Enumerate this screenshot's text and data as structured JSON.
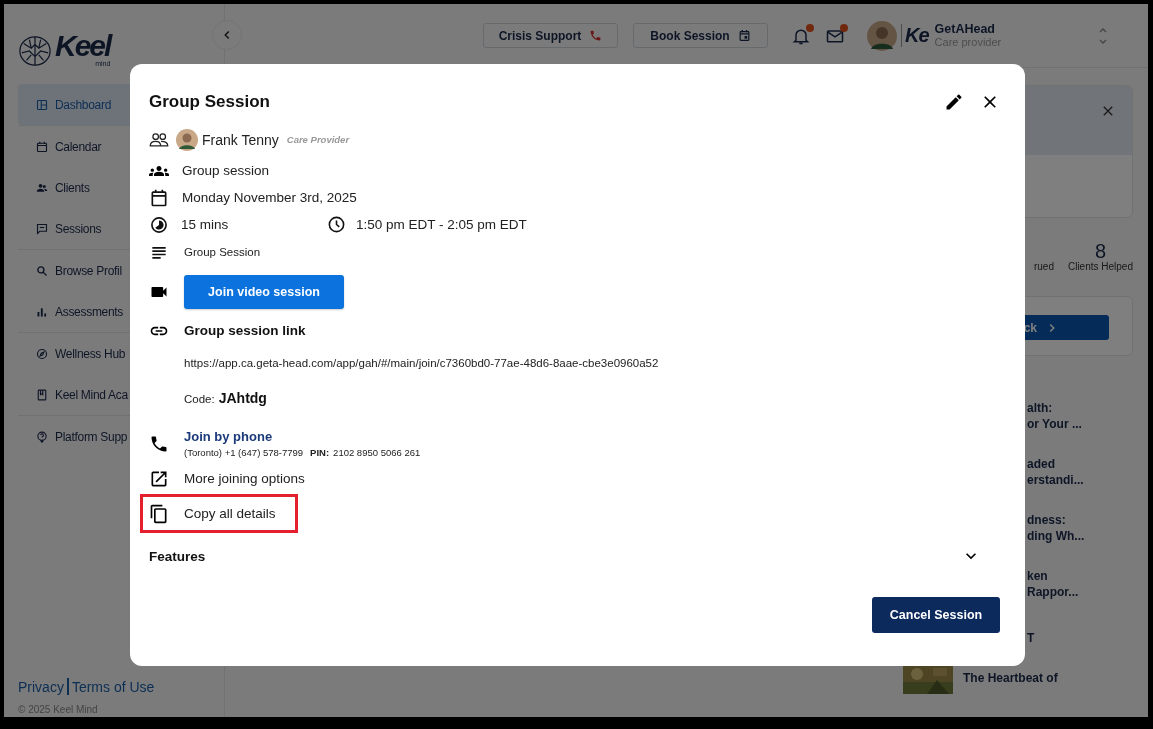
{
  "sidebar": {
    "brand": {
      "name": "Keel",
      "tagline": "mind"
    },
    "groups": [
      {
        "items": [
          {
            "label": "Dashboard",
            "selected": true
          }
        ]
      },
      {
        "items": [
          {
            "label": "Calendar",
            "selected": false
          },
          {
            "label": "Clients",
            "selected": false
          },
          {
            "label": "Sessions",
            "selected": false
          }
        ]
      },
      {
        "items": [
          {
            "label": "Browse Profil",
            "selected": false
          },
          {
            "label": "Assessments",
            "selected": false
          }
        ]
      },
      {
        "items": [
          {
            "label": "Wellness Hub",
            "selected": false
          },
          {
            "label": "Keel Mind Aca",
            "selected": false
          }
        ]
      },
      {
        "items": [
          {
            "label": "Platform Supp",
            "selected": false
          }
        ]
      }
    ],
    "footer_links": [
      "Privacy",
      "Terms of Use"
    ],
    "copyright": "© 2025 Keel Mind"
  },
  "header": {
    "crisis_button": "Crisis Support",
    "book_button": "Book Session",
    "notifications_unread": true,
    "messages_unread": true,
    "user": {
      "partner_logo": "Ke",
      "name": "GetAHead",
      "role": "Care provider"
    }
  },
  "dashboard": {
    "stats": [
      {
        "label": "rued"
      },
      {
        "value": "8",
        "label": "Clients Helped"
      }
    ],
    "action_button": "ck",
    "articles": [
      {
        "kind": "covered",
        "lines": [
          "alth:",
          "or Your ..."
        ]
      },
      {
        "kind": "covered",
        "lines": [
          "aded",
          "erstandi..."
        ]
      },
      {
        "kind": "covered",
        "lines": [
          "dness:",
          "ding Wh..."
        ]
      },
      {
        "kind": "covered",
        "lines": [
          "ken",
          "Rappor..."
        ]
      },
      {
        "kind": "covered",
        "lines": [
          "T"
        ]
      },
      {
        "kind": "thumb",
        "lines": [
          "The Heartbeat of"
        ]
      }
    ]
  },
  "modal": {
    "title": "Group Session",
    "host": {
      "name": "Frank Tenny",
      "role": "Care Provider"
    },
    "session_type": "Group session",
    "date": "Monday November 3rd, 2025",
    "duration": "15 mins",
    "time_range": "1:50 pm EDT - 2:05 pm EDT",
    "description": "Group Session",
    "join_button": "Join video session",
    "link_heading": "Group session link",
    "link_url": "https://app.ca.geta-head.com/app/gah/#/main/join/c7360bd0-77ae-48d6-8aae-cbe3e0960a52",
    "code_label": "Code:",
    "code": "JAhtdg",
    "phone": {
      "heading": "Join by phone",
      "number": "(Toronto) +1 (647) 578-7799",
      "pin_label": "PIN:",
      "pin": "2102 8950 5066 261"
    },
    "options": [
      {
        "label": "More joining options",
        "highlighted": false
      },
      {
        "label": "Copy all details",
        "highlighted": true
      }
    ],
    "features": {
      "label": "Features",
      "expanded": false
    },
    "cancel_button": "Cancel Session"
  }
}
